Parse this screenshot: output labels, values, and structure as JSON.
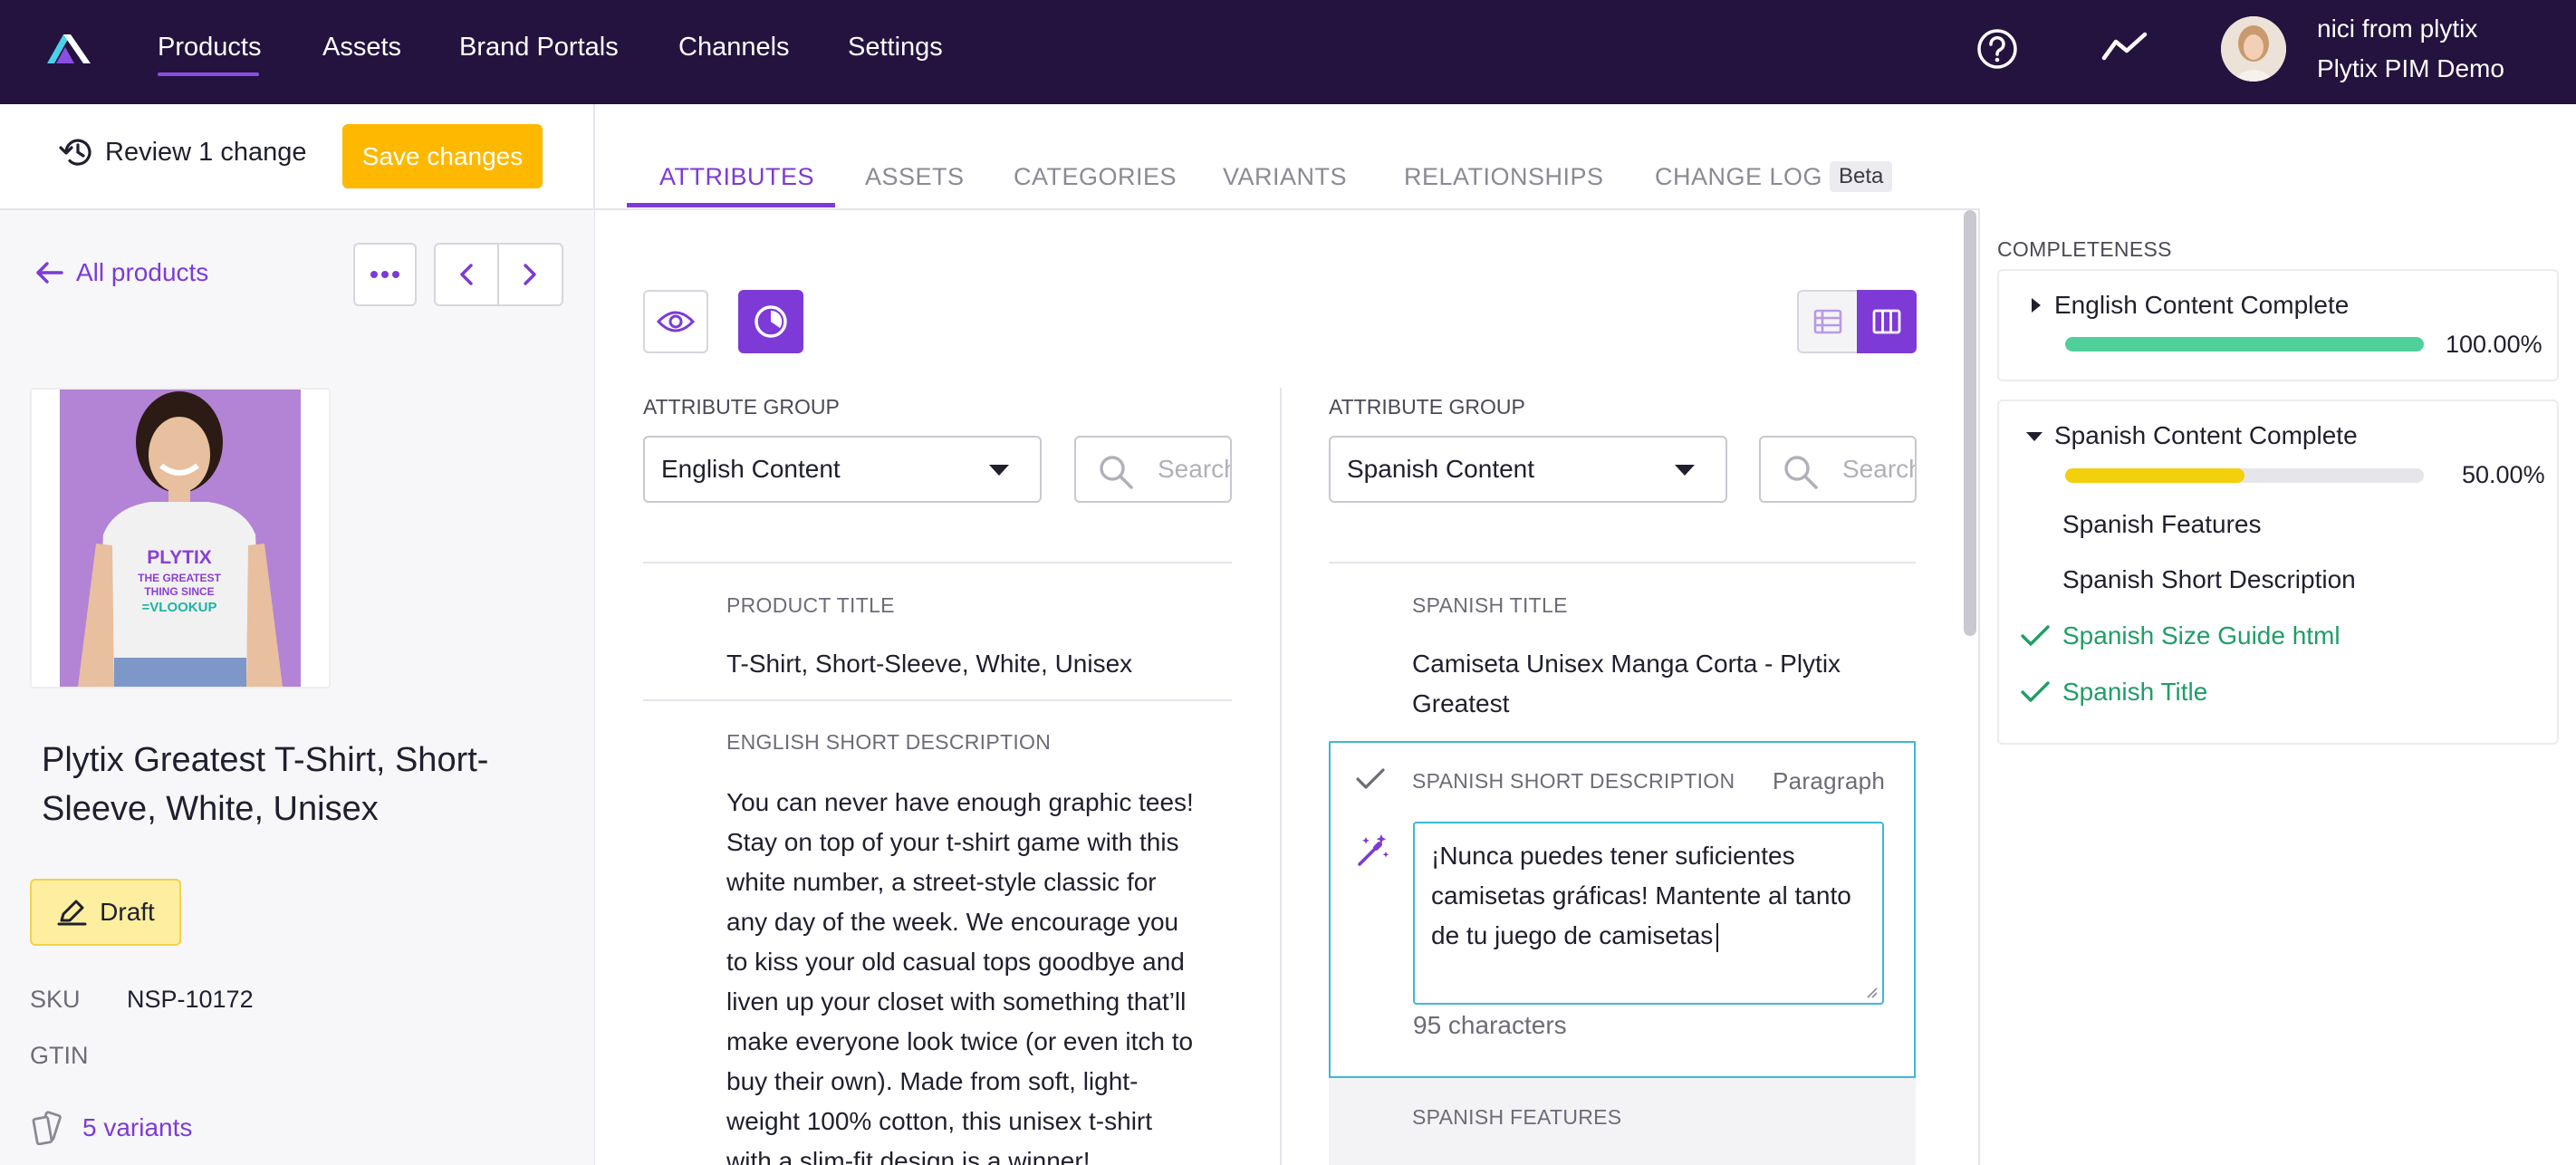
{
  "nav": {
    "items": [
      "Products",
      "Assets",
      "Brand Portals",
      "Channels",
      "Settings"
    ],
    "user_name": "nici from plytix",
    "org_name": "Plytix PIM Demo"
  },
  "actions": {
    "review_label": "Review 1 change",
    "save_label": "Save changes"
  },
  "tabs": [
    "ATTRIBUTES",
    "ASSETS",
    "CATEGORIES",
    "VARIANTS",
    "RELATIONSHIPS",
    "CHANGE LOG"
  ],
  "tabs_badge": "Beta",
  "sidebar": {
    "back_label": "All products",
    "product_title": "Plytix Greatest T-Shirt, Short-Sleeve, White, Unisex",
    "status": "Draft",
    "sku_label": "SKU",
    "sku_value": "NSP-10172",
    "gtin_label": "GTIN",
    "variants_label": "5 variants",
    "shirt_print": [
      "PLYTIX",
      "THE GREATEST",
      "THING SINCE",
      "=VLOOKUP"
    ]
  },
  "left_column": {
    "group_label": "ATTRIBUTE GROUP",
    "group_value": "English Content",
    "search_placeholder": "Search",
    "fields": [
      {
        "label": "PRODUCT TITLE",
        "value": "T-Shirt, Short-Sleeve, White, Unisex"
      },
      {
        "label": "ENGLISH SHORT DESCRIPTION",
        "lines": [
          "You can never have enough graphic tees!",
          "Stay on top of your t-shirt game with this",
          "white number, a street-style classic for",
          "any day of the week. We encourage you",
          "to kiss your old casual tops goodbye and",
          "liven up your closet with something that’ll",
          "make everyone look twice (or even itch to",
          "buy their own). Made from soft, light-",
          "weight 100% cotton, this unisex t-shirt",
          "with a slim-fit design is a winner!"
        ]
      }
    ]
  },
  "right_column": {
    "group_label": "ATTRIBUTE GROUP",
    "group_value": "Spanish Content",
    "search_placeholder": "Search",
    "title_label": "SPANISH TITLE",
    "title_lines": [
      "Camiseta Unisex Manga Corta - Plytix",
      "Greatest"
    ],
    "desc_label": "SPANISH SHORT DESCRIPTION",
    "desc_type": "Paragraph",
    "desc_lines": [
      "¡Nunca puedes tener suficientes",
      "camisetas gráficas! Mantente al tanto",
      "de tu juego de camisetas"
    ],
    "desc_count": "95 characters",
    "features_label": "SPANISH FEATURES"
  },
  "completeness": {
    "title": "COMPLETENESS",
    "groups": [
      {
        "name": "English Content Complete",
        "percent_text": "100.00%",
        "fraction": 1.0,
        "color": "#4fcf9a",
        "expanded": false
      },
      {
        "name": "Spanish Content Complete",
        "percent_text": "50.00%",
        "fraction": 0.5,
        "color": "#f2d00b",
        "expanded": true,
        "requirements": [
          {
            "name": "Spanish Features",
            "done": false
          },
          {
            "name": "Spanish Short Description",
            "done": false
          },
          {
            "name": "Spanish Size Guide html",
            "done": true
          },
          {
            "name": "Spanish Title",
            "done": true
          }
        ]
      }
    ]
  },
  "colors": {
    "nav_bg": "#24123f",
    "accent": "#7d3ad6",
    "save": "#ffb800",
    "done": "#1f9e66"
  }
}
